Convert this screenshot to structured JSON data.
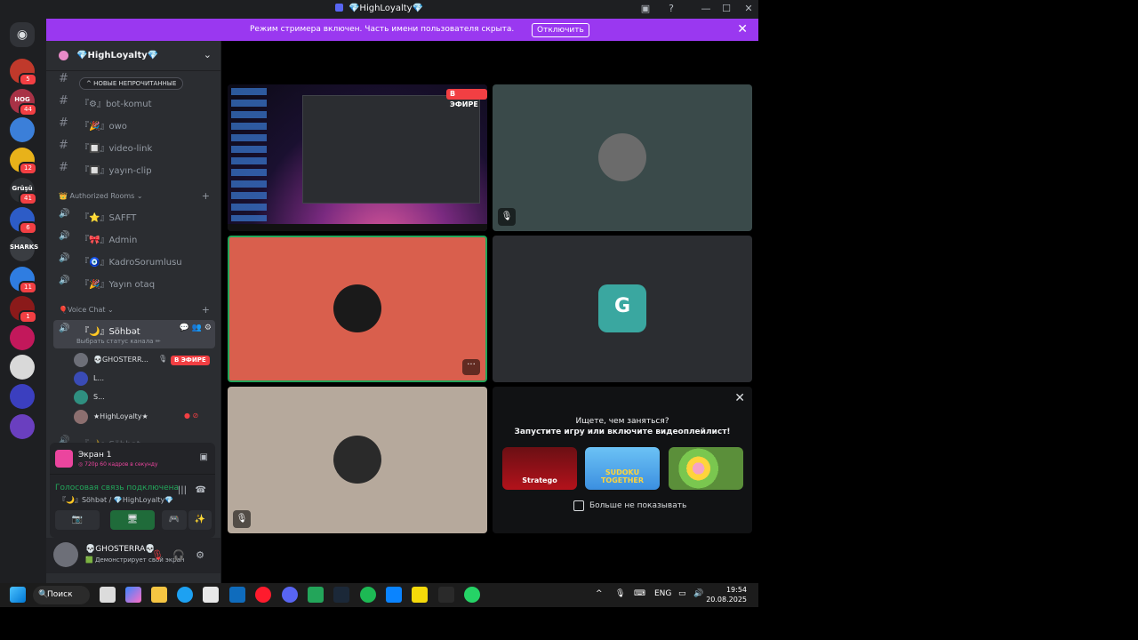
{
  "window": {
    "title": "💎HighLoyalty💎",
    "controls": [
      "▣",
      "?",
      "—",
      "☐",
      "✕"
    ]
  },
  "banner": {
    "text": "Режим стримера включен. Часть имени пользователя скрыта.",
    "button": "Отключить",
    "close": "✕",
    "color": "#9a38f0"
  },
  "servers": [
    {
      "color": "#c0392b",
      "badge": "5",
      "label": ""
    },
    {
      "color": "#a83246",
      "badge": "44",
      "label": "HOG"
    },
    {
      "color": "#3b7fd9",
      "badge": "",
      "label": ""
    },
    {
      "color": "#e8b21a",
      "badge": "12",
      "label": ""
    },
    {
      "color": "#2c2f33",
      "badge": "41",
      "label": "Grüşü"
    },
    {
      "color": "#2d5cc7",
      "badge": "6",
      "label": ""
    },
    {
      "color": "#3a3d42",
      "badge": "",
      "label": "SHARKS"
    },
    {
      "color": "#2f7de1",
      "badge": "11",
      "label": ""
    },
    {
      "color": "#8b1a1a",
      "badge": "1",
      "label": ""
    },
    {
      "color": "#c2185b",
      "badge": "",
      "label": ""
    },
    {
      "color": "#d9d9d9",
      "badge": "",
      "label": ""
    },
    {
      "color": "#3b3fbf",
      "badge": "",
      "label": ""
    },
    {
      "color": "#6a3fbf",
      "badge": "",
      "label": ""
    }
  ],
  "sidebar": {
    "server_name": "💎HighLoyalty💎",
    "new_unread": "^ НОВЫЕ НЕПРОЧИТАННЫЕ",
    "text_channels": [
      {
        "name": "『⚙』bot-komut"
      },
      {
        "name": "『🎉』owo"
      },
      {
        "name": "『🔲』video-link"
      },
      {
        "name": "『🔲』yayın-clip"
      }
    ],
    "cat_authorized": "👑 Authorized Rooms ⌄",
    "authorized_rooms": [
      {
        "name": "『⭐』SAFFT"
      },
      {
        "name": "『🎀』Admin"
      },
      {
        "name": "『🧿』KadroSorumlusu"
      },
      {
        "name": "『🎉』Yayın otaq"
      }
    ],
    "cat_voice": "🎈Voice Chat ⌄",
    "active_voice": {
      "name": "『🌙』Söhbət",
      "status": "Выбрать статус канала ✏",
      "icons": "💬 👥 ⚙"
    },
    "members": [
      {
        "name": "💀GHOSTERR...",
        "live": "В ЭФИРЕ",
        "color": "#6d6f78"
      },
      {
        "name": "L...",
        "live": "",
        "color": "#3a4bb5"
      },
      {
        "name": "S...",
        "live": "",
        "color": "#2f8f80"
      },
      {
        "name": "★HighLoyalty★",
        "live": "",
        "color": "#8c6f6f"
      }
    ],
    "next_channel": "『🌙』Söhbət"
  },
  "rtc": {
    "screen_title": "Экран 1",
    "screen_sub": "◎ 720p 60 кадров в секунду",
    "voice_connected": "Голосовая связь подключена",
    "voice_channel": "『🌙』Söhbət / 💎HighLoyalty💎",
    "buttons": [
      "📷",
      "🖥",
      "🎮",
      "✨"
    ]
  },
  "user": {
    "name": "💀GHOSTERRA💀",
    "status": "🟩 Демонстрирует свой экран"
  },
  "stage": {
    "live_badge": "В ЭФИРЕ",
    "tile_colors": {
      "stream": "#1a1020",
      "skull": "#3a4a4a",
      "red": "#d95f4d",
      "g": "#2b2d31",
      "bw": "#b6a99c"
    }
  },
  "suggest": {
    "line1": "Ищете, чем заняться?",
    "line2": "Запустите игру или включите видеоплейлист!",
    "games": [
      {
        "title": "Stratego",
        "color": "#b3121b"
      },
      {
        "title": "SUDOKU TOGETHER",
        "color": "#3b8fe0"
      },
      {
        "title": "",
        "color": "#9ab04e"
      }
    ],
    "checkbox": "Больше не показывать"
  },
  "taskbar": {
    "search": "Поиск",
    "lang": "ENG",
    "time": "19:54",
    "date": "20.08.2025"
  }
}
